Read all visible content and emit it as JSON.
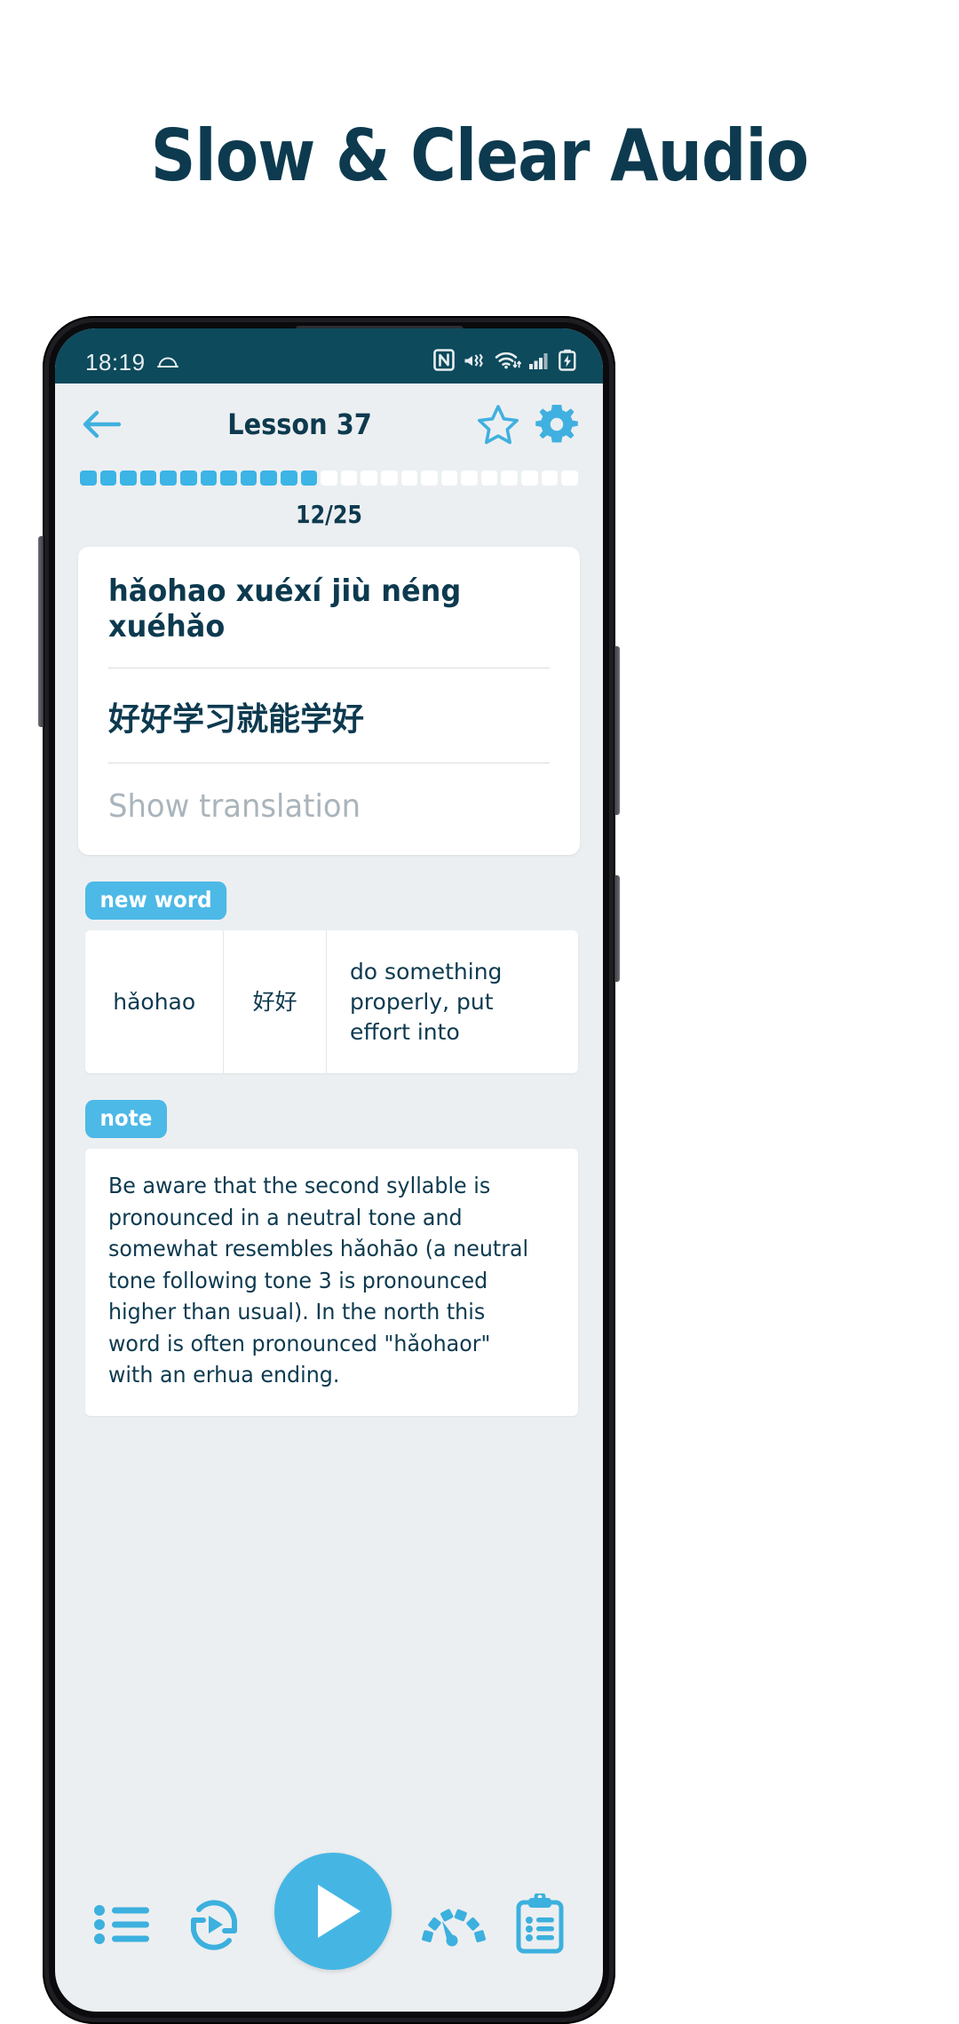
{
  "headline": "Slow & Clear Audio",
  "colors": {
    "headline": "#0d3a4f",
    "accent_cyan": "#3cb4e5",
    "statusbar_bg": "#0d4a5c",
    "screen_bg": "#eceff1",
    "card_bg": "#ffffff",
    "muted_text": "#aab4bb"
  },
  "statusbar": {
    "time": "18:19",
    "left_icons": [
      "weather-cloud-icon"
    ],
    "right_icons": [
      "nfc-icon",
      "mute-vibrate-icon",
      "wifi-icon",
      "signal-bars-icon",
      "battery-charging-icon"
    ]
  },
  "appbar": {
    "back_icon": "back-arrow-icon",
    "title": "Lesson 37",
    "star_icon": "star-outline-icon",
    "settings_icon": "gear-icon"
  },
  "progress": {
    "total": 25,
    "completed": 12,
    "counter": "12/25"
  },
  "sentence_card": {
    "pinyin": "hǎohao xuéxí jiù néng xuéhǎo",
    "hanzi": "好好学习就能学好",
    "translation_placeholder": "Show translation"
  },
  "new_word": {
    "badge": "new word",
    "pinyin": "hǎohao",
    "hanzi": "好好",
    "meaning": "do something properly, put effort into"
  },
  "note": {
    "badge": "note",
    "text": "Be aware that the second syllable is pronounced in a neutral tone and somewhat resembles hǎohāo (a neutral tone following tone 3 is pronounced higher than usual). In the north this word is often pronounced \"hǎohaor\" with an erhua ending."
  },
  "bottombar": {
    "items": [
      {
        "icon": "list-icon",
        "name": "sentence-list-button"
      },
      {
        "icon": "repeat-play-icon",
        "name": "repeat-button"
      },
      {
        "icon": "play-icon",
        "name": "play-button"
      },
      {
        "icon": "speed-gauge-icon",
        "name": "playback-speed-button"
      },
      {
        "icon": "clipboard-list-icon",
        "name": "exercises-button"
      }
    ]
  }
}
